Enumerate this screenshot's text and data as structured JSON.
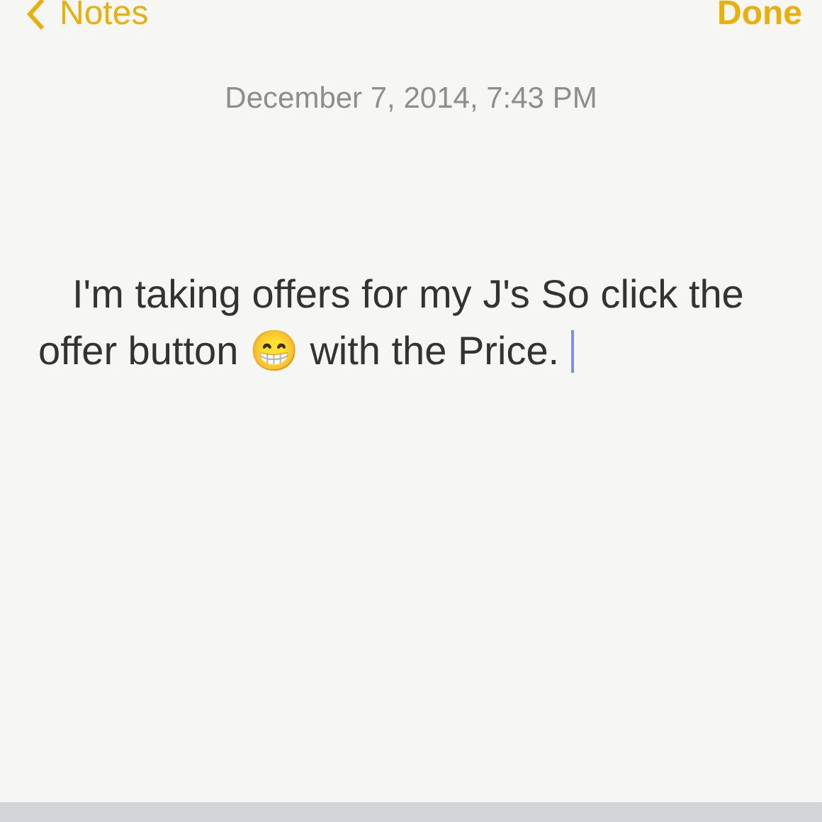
{
  "nav": {
    "back_label": "Notes",
    "done_label": "Done"
  },
  "note": {
    "date": "December 7, 2014, 7:43 PM",
    "body": "I'm taking offers for my J's So click the offer button 😁 with the Price.",
    "cursor": true
  }
}
